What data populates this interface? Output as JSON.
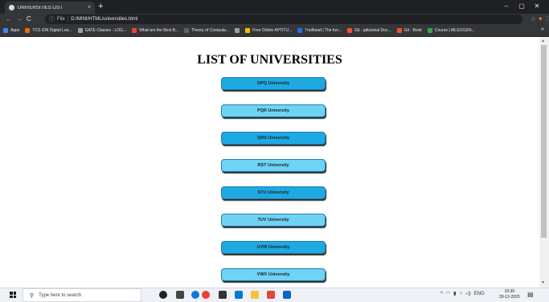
{
  "browser": {
    "tab_title": "UNIVERSITIES LIST",
    "tab_close": "×",
    "new_tab": "+",
    "window_controls": {
      "minimize": "–",
      "maximize": "▢",
      "close": "✕"
    },
    "nav": {
      "back": "←",
      "forward": "→",
      "reload": "C"
    },
    "address": {
      "scheme": "File",
      "url": "D:/MINI/HTML/universities.html"
    },
    "bookmarks": [
      {
        "label": "Apps",
        "color": "#4285f4"
      },
      {
        "label": "TCS iON Digital Lea...",
        "color": "#e8710a"
      },
      {
        "label": "GATE Classes - LOG...",
        "color": "#9aa0a6"
      },
      {
        "label": "What are the Best B...",
        "color": "#ea4335"
      },
      {
        "label": "Theory of Computa...",
        "color": "#5f6368"
      },
      {
        "label": "",
        "color": "#9aa0a6"
      },
      {
        "label": "Free Online APTITU...",
        "color": "#fbbc04"
      },
      {
        "label": "Trailhead | The fun...",
        "color": "#1a73e8"
      },
      {
        "label": "Git - gittutorial Doc...",
        "color": "#f05033"
      },
      {
        "label": "Git - Book",
        "color": "#f05033"
      },
      {
        "label": "Course | MLS101EN...",
        "color": "#34a853"
      }
    ],
    "bookmarks_more": "»"
  },
  "page": {
    "heading": "LIST OF UNIVERSITIES",
    "universities": [
      {
        "label": "OPQ University",
        "style": "dark"
      },
      {
        "label": "PQR University",
        "style": "light"
      },
      {
        "label": "QRS University",
        "style": "dark"
      },
      {
        "label": "RST University",
        "style": "light"
      },
      {
        "label": "STU University",
        "style": "dark"
      },
      {
        "label": "TUV University",
        "style": "light"
      },
      {
        "label": "UVW University",
        "style": "dark"
      },
      {
        "label": "VWX University",
        "style": "light"
      }
    ]
  },
  "taskbar": {
    "search_placeholder": "Type here to search",
    "apps": [
      {
        "icon": "cortana-icon",
        "color": "#222222"
      },
      {
        "icon": "task-view-icon",
        "color": "#444444"
      },
      {
        "icon": "edge-icon",
        "color": "#0f7bd8"
      },
      {
        "icon": "chrome-icon",
        "color": "#ea4335"
      },
      {
        "icon": "store-icon",
        "color": "#333333"
      },
      {
        "icon": "mail-icon",
        "color": "#0078d4"
      },
      {
        "icon": "file-explorer-icon",
        "color": "#f8c338"
      },
      {
        "icon": "app-red-icon",
        "color": "#e2463a"
      },
      {
        "icon": "app-blue-icon",
        "color": "#0a66c2"
      }
    ],
    "language": "ENG",
    "time": "19:39",
    "date": "29-12-2020"
  }
}
